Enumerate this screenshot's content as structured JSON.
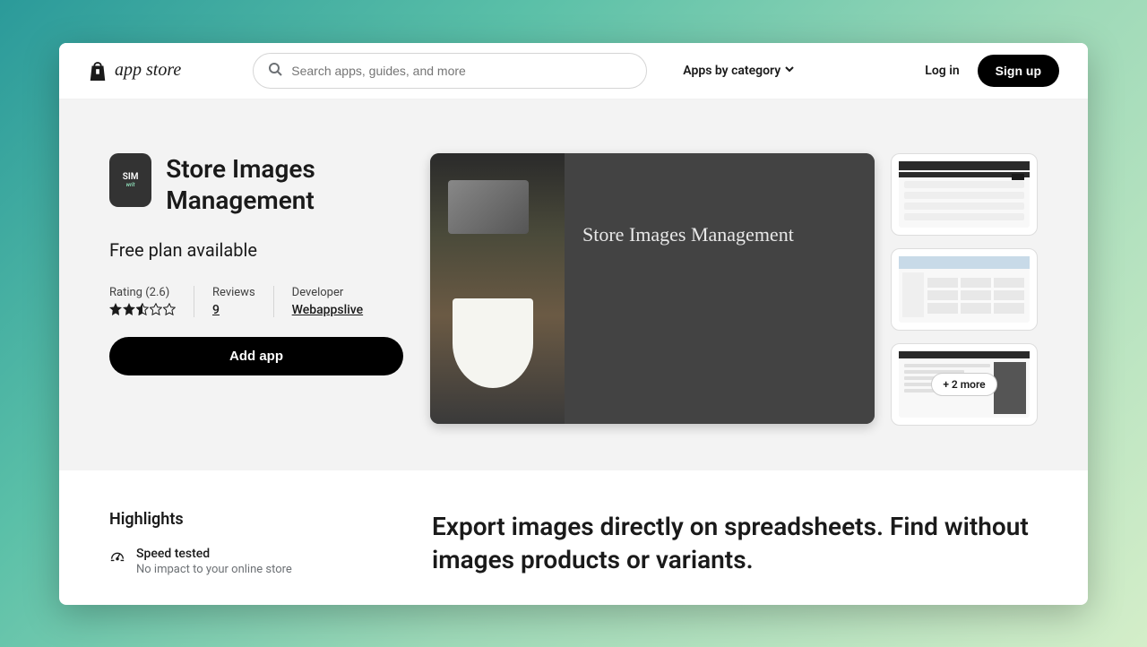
{
  "header": {
    "logo_text": "app store",
    "search_placeholder": "Search apps, guides, and more",
    "category_label": "Apps by category",
    "login": "Log in",
    "signup": "Sign up"
  },
  "app": {
    "icon_text": "SIM",
    "icon_sub": "writ",
    "name": "Store Images Management",
    "plan": "Free plan available",
    "rating_label": "Rating (2.6)",
    "rating_value": 2.6,
    "reviews_label": "Reviews",
    "reviews_count": "9",
    "developer_label": "Developer",
    "developer_name": "Webappslive",
    "add_button": "Add app",
    "hero_caption": "Store Images Management",
    "more_badge": "+ 2 more"
  },
  "highlights": {
    "title": "Highlights",
    "items": [
      {
        "title": "Speed tested",
        "sub": "No impact to your online store"
      }
    ]
  },
  "description": {
    "headline": "Export images directly on spreadsheets. Find without images products or variants."
  }
}
